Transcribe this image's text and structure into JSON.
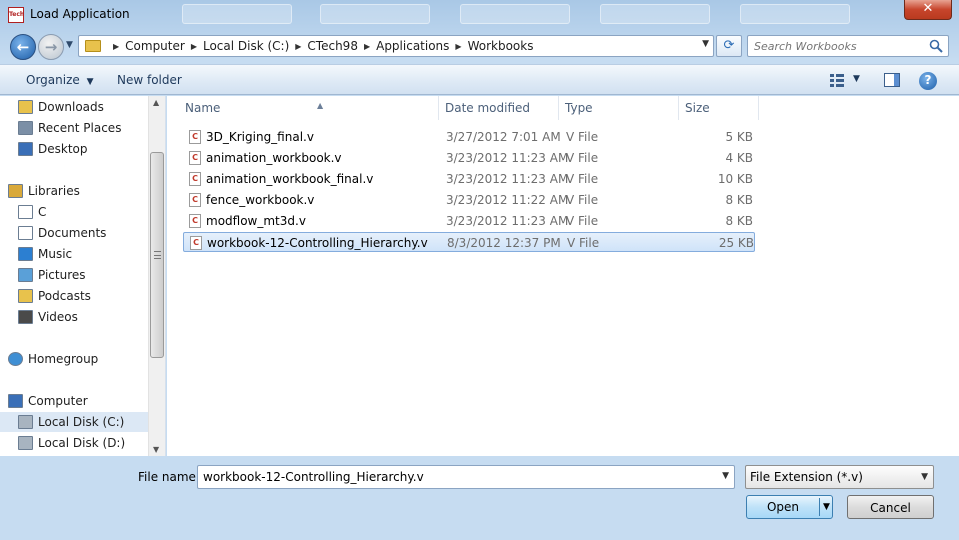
{
  "window": {
    "title": "Load Application",
    "app_icon_text": "Tech"
  },
  "address": {
    "crumbs": [
      "Computer",
      "Local Disk (C:)",
      "CTech98",
      "Applications",
      "Workbooks"
    ]
  },
  "search": {
    "placeholder": "Search Workbooks"
  },
  "toolbar": {
    "organize": "Organize",
    "new_folder": "New folder"
  },
  "navpane": {
    "items": [
      {
        "label": "Downloads",
        "icon": "downloads-folder-icon",
        "selected": false
      },
      {
        "label": "Recent Places",
        "icon": "recent-places-icon",
        "selected": false
      },
      {
        "label": "Desktop",
        "icon": "desktop-icon",
        "selected": false
      },
      {
        "label": "Libraries",
        "icon": "libraries-icon",
        "selected": false
      },
      {
        "label": "C",
        "icon": "document-icon",
        "selected": false
      },
      {
        "label": "Documents",
        "icon": "documents-icon",
        "selected": false
      },
      {
        "label": "Music",
        "icon": "music-icon",
        "selected": false
      },
      {
        "label": "Pictures",
        "icon": "pictures-icon",
        "selected": false
      },
      {
        "label": "Podcasts",
        "icon": "podcasts-folder-icon",
        "selected": false
      },
      {
        "label": "Videos",
        "icon": "videos-icon",
        "selected": false
      },
      {
        "label": "Homegroup",
        "icon": "homegroup-icon",
        "selected": false
      },
      {
        "label": "Computer",
        "icon": "computer-icon",
        "selected": false
      },
      {
        "label": "Local Disk (C:)",
        "icon": "drive-icon",
        "selected": true
      },
      {
        "label": "Local Disk (D:)",
        "icon": "drive-icon",
        "selected": false
      }
    ]
  },
  "columns": {
    "name": "Name",
    "date": "Date modified",
    "type": "Type",
    "size": "Size"
  },
  "files": [
    {
      "name": "3D_Kriging_final.v",
      "date": "3/27/2012 7:01 AM",
      "type": "V File",
      "size": "5 KB",
      "selected": false
    },
    {
      "name": "animation_workbook.v",
      "date": "3/23/2012 11:23 AM",
      "type": "V File",
      "size": "4 KB",
      "selected": false
    },
    {
      "name": "animation_workbook_final.v",
      "date": "3/23/2012 11:23 AM",
      "type": "V File",
      "size": "10 KB",
      "selected": false
    },
    {
      "name": "fence_workbook.v",
      "date": "3/23/2012 11:22 AM",
      "type": "V File",
      "size": "8 KB",
      "selected": false
    },
    {
      "name": "modflow_mt3d.v",
      "date": "3/23/2012 11:23 AM",
      "type": "V File",
      "size": "8 KB",
      "selected": false
    },
    {
      "name": "workbook-12-Controlling_Hierarchy.v",
      "date": "8/3/2012 12:37 PM",
      "type": "V File",
      "size": "25 KB",
      "selected": true
    }
  ],
  "file_icon_glyph": "C",
  "bottom": {
    "file_name_label": "File name:",
    "file_name_value": "workbook-12-Controlling_Hierarchy.v",
    "filter": "File Extension (*.v)",
    "open": "Open",
    "cancel": "Cancel"
  }
}
